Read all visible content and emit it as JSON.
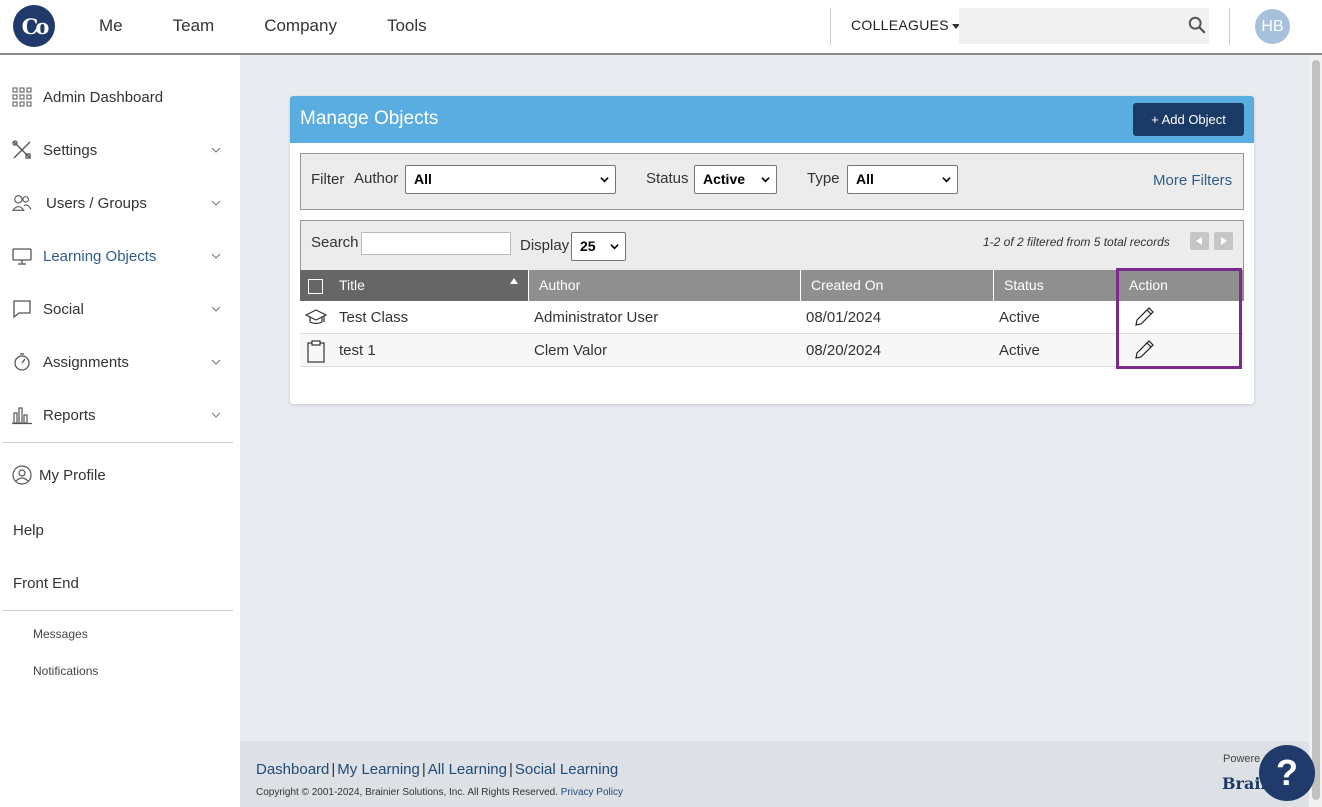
{
  "app": {
    "logo_text": "Co"
  },
  "topnav": {
    "items": [
      "Me",
      "Team",
      "Company",
      "Tools"
    ],
    "colleagues_label": "COLLEAGUES",
    "search_placeholder": "",
    "avatar_initials": "HB"
  },
  "sidebar": {
    "items": [
      {
        "label": "Admin Dashboard",
        "icon": "grid-icon",
        "expandable": false
      },
      {
        "label": "Settings",
        "icon": "tools-icon",
        "expandable": true
      },
      {
        "label": "Users / Groups",
        "icon": "users-icon",
        "expandable": true
      },
      {
        "label": "Learning Objects",
        "icon": "monitor-icon",
        "expandable": true,
        "active": true
      },
      {
        "label": "Social",
        "icon": "chat-bubble-icon",
        "expandable": true
      },
      {
        "label": "Assignments",
        "icon": "stopwatch-icon",
        "expandable": true
      },
      {
        "label": "Reports",
        "icon": "bar-chart-icon",
        "expandable": true
      }
    ],
    "my_profile": "My Profile",
    "help": "Help",
    "front_end": "Front End",
    "messages": "Messages",
    "notifications": "Notifications"
  },
  "panel": {
    "title": "Manage Objects",
    "add_button": "+ Add Object",
    "filter": {
      "filter_label": "Filter",
      "author_label": "Author",
      "author_value": "All",
      "status_label": "Status",
      "status_value": "Active",
      "type_label": "Type",
      "type_value": "All",
      "more_filters": "More Filters"
    },
    "list": {
      "search_label": "Search",
      "search_value": "",
      "display_label": "Display",
      "display_value": "25",
      "records_text": "1-2 of 2 filtered from 5 total records"
    },
    "columns": [
      "Title",
      "Author",
      "Created On",
      "Status",
      "Action"
    ],
    "rows": [
      {
        "icon": "graduation-cap-icon",
        "title": "Test Class",
        "author": "Administrator User",
        "created_on": "08/01/2024",
        "status": "Active"
      },
      {
        "icon": "clipboard-icon",
        "title": "test 1",
        "author": "Clem Valor",
        "created_on": "08/20/2024",
        "status": "Active"
      }
    ]
  },
  "footer": {
    "links": [
      "Dashboard",
      "My Learning",
      "All Learning",
      "Social Learning"
    ],
    "copyright": "Copyright © 2001-2024, Brainier Solutions, Inc. All Rights Reserved.",
    "privacy_policy": "Privacy Policy",
    "powered_by": "Powere",
    "brand": "Brain"
  },
  "colors": {
    "header_blue": "#5aade0",
    "navy": "#1c3a66",
    "highlight_purple": "#7a2b8c",
    "main_bg": "#e8ebef"
  }
}
